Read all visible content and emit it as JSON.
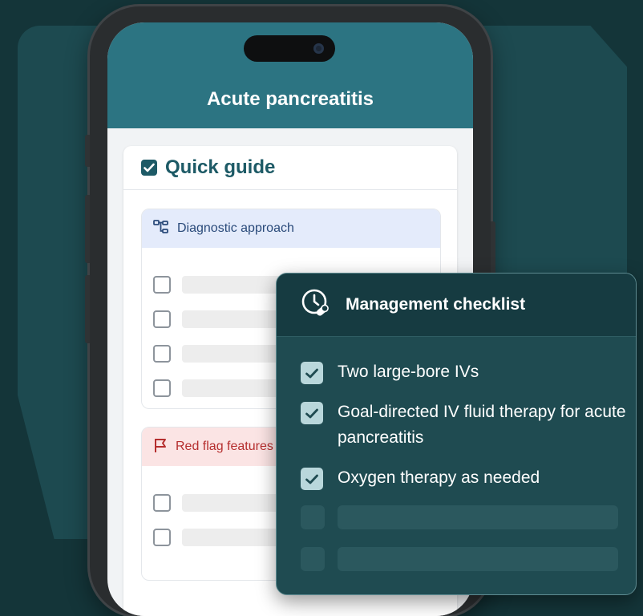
{
  "app": {
    "title": "Acute pancreatitis"
  },
  "quick_guide": {
    "title": "Quick guide",
    "sections": [
      {
        "label": "Diagnostic approach",
        "icon": "flow-chart-icon",
        "color": "#2a4a7a"
      },
      {
        "label": "Red flag features",
        "icon": "flag-icon",
        "color": "#b52e2e"
      }
    ]
  },
  "management": {
    "title": "Management checklist",
    "icon": "clock-pill-icon",
    "items": [
      {
        "label": "Two large-bore IVs",
        "checked": true
      },
      {
        "label": "Goal-directed IV fluid therapy for acute pancreatitis",
        "checked": true
      },
      {
        "label": "Oxygen therapy as needed",
        "checked": true
      }
    ]
  },
  "colors": {
    "background": "#143539",
    "header": "#2c7482",
    "accent": "#1d5a66",
    "overlay": "#1f4b51"
  }
}
